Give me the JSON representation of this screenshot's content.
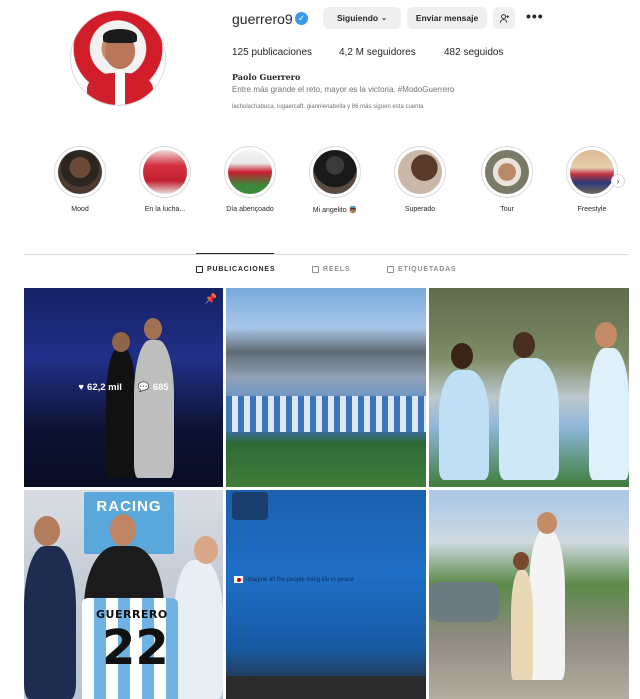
{
  "profile": {
    "username": "guerrero9",
    "verified_icon": "check",
    "follow_button": "Siguiendo",
    "message_button": "Enviar mensaje",
    "add_person_icon": "person-plus-icon",
    "more_icon": "•••",
    "stats": {
      "posts": "125 publicaciones",
      "followers": "4,2 M seguidores",
      "following": "482 seguidos"
    },
    "full_name": "Paolo Guerrero",
    "bio": "Entre más grande el reto, mayor es la victoria. #ModoGuerrero",
    "followed_by": "lacholachabuca, lugaercaft, giannienabella y 86 más siguen esta cuenta"
  },
  "highlights": [
    {
      "label": "Mood"
    },
    {
      "label": "En la lucha..."
    },
    {
      "label": "Día abençoado"
    },
    {
      "label": "Mi angelito 👼🏽"
    },
    {
      "label": "Superado"
    },
    {
      "label": "Tour"
    },
    {
      "label": "Freestyle"
    }
  ],
  "tabs": [
    {
      "label": "PUBLICACIONES",
      "active": true
    },
    {
      "label": "REELS",
      "active": false
    },
    {
      "label": "ETIQUETADAS",
      "active": false
    }
  ],
  "posts": [
    {
      "likes": "62,2 mil",
      "comments": "685",
      "pinned": true
    },
    {},
    {},
    {
      "jersey_name": "GUERRERO",
      "jersey_number": "22",
      "sign": "RACING"
    },
    {
      "caption_on_image": "Imagine all the people living life in peace"
    },
    {}
  ],
  "colors": {
    "accent": "#3897f0",
    "button_bg": "#efefef",
    "text": "#262626",
    "muted": "#737373"
  }
}
